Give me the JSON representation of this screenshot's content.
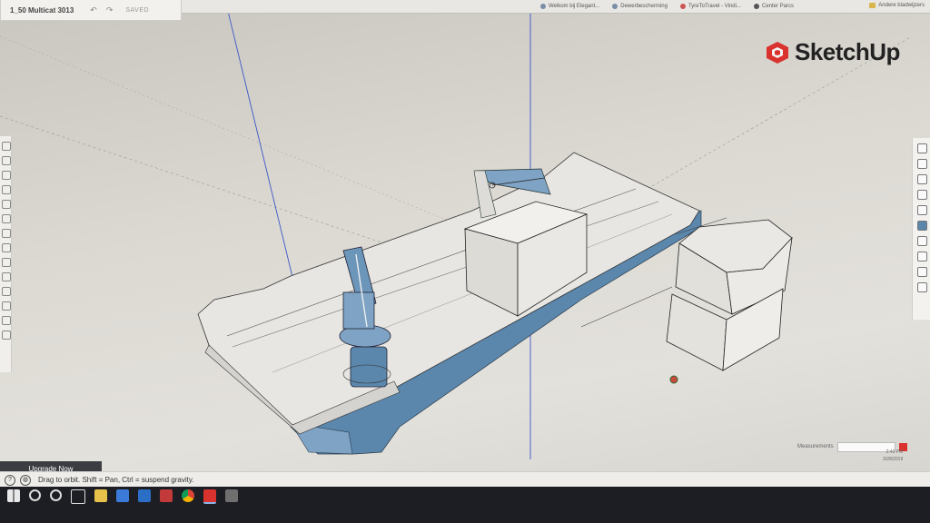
{
  "window": {
    "title": "1_50 Multicat 3013",
    "save_status": "SAVED"
  },
  "browser_bookmarks": [
    {
      "label": "Welkom bij Elegant..."
    },
    {
      "label": "Dewerbescherming"
    },
    {
      "label": "TyreToTravel - Vindi..."
    },
    {
      "label": "Center Parcs"
    }
  ],
  "browser_more": "Andere bladwijzers",
  "brand": {
    "name": "SketchUp",
    "accent_color": "#d9322f"
  },
  "colors": {
    "hull_blue": "#5b87ad",
    "model_fill": "#e7e6e2",
    "axis_blue": "#3a55c8"
  },
  "upgrade_button": "Upgrade Now",
  "measurements_label": "Measurements",
  "status": {
    "hint": "Drag to orbit. Shift = Pan, Ctrl = suspend gravity."
  },
  "clock": {
    "time": "2:40 PM",
    "date": "3/28/2019"
  },
  "left_toolbar_icons": [
    "select-icon",
    "eraser-icon",
    "line-icon",
    "arc-icon",
    "rectangle-icon",
    "push-pull-icon",
    "move-icon",
    "rotate-icon",
    "scale-icon",
    "offset-icon",
    "tape-icon",
    "text-icon",
    "paint-icon",
    "orbit-icon"
  ],
  "right_panel_icons": [
    "entity-info-icon",
    "instructor-icon",
    "components-icon",
    "materials-icon",
    "styles-icon",
    "layers-icon",
    "scenes-icon",
    "shadows-icon",
    "display-icon",
    "outliner-icon"
  ],
  "taskbar_icons": [
    "windows-start-icon",
    "search-icon",
    "cortana-icon",
    "task-view-icon",
    "file-explorer-icon",
    "store-icon",
    "mail-icon",
    "media-icon",
    "chrome-icon",
    "sketchup-app-icon",
    "calculator-icon"
  ]
}
